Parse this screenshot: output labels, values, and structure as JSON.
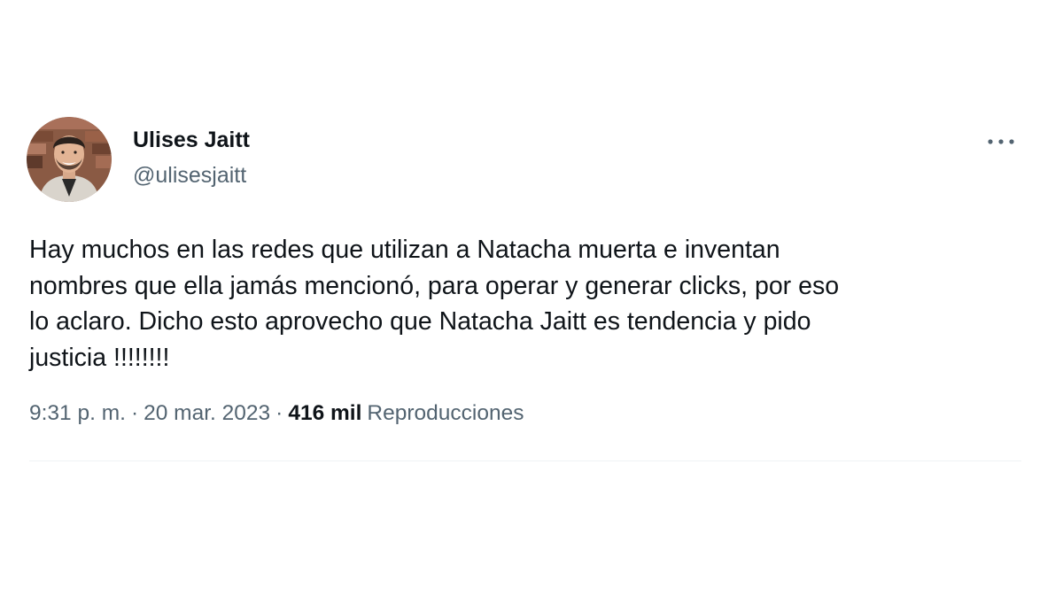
{
  "author": {
    "display_name": "Ulises Jaitt",
    "handle": "@ulisesjaitt",
    "avatar_icon": "profile-photo"
  },
  "tweet": {
    "text": "Hay muchos en las redes que utilizan a Natacha muerta e inventan\nnombres que ella jamás mencionó, para operar y generar clicks, por eso\nlo aclaro. Dicho esto aprovecho que Natacha Jaitt es tendencia y pido\njusticia !!!!!!!!"
  },
  "meta": {
    "time": "9:31 p. m.",
    "separator": "·",
    "date": "20 mar. 2023",
    "views_count": "416 mil",
    "views_label": "Reproducciones"
  },
  "icons": {
    "more": "more-horizontal-icon"
  },
  "colors": {
    "text_primary": "#0f1419",
    "text_secondary": "#536471",
    "divider": "#eff3f4"
  }
}
